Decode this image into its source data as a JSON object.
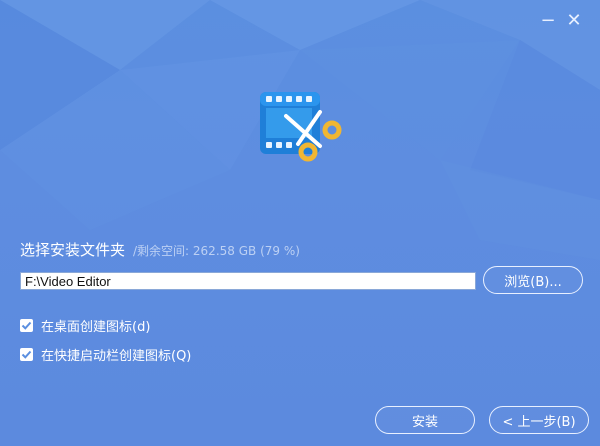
{
  "window": {
    "minimize_glyph": "−",
    "close_glyph": "✕"
  },
  "logo": {
    "icon": "video-editor-scissors-icon"
  },
  "folder": {
    "title": "选择安装文件夹",
    "space_info": "/剩余空间: 262.58 GB (79 %)",
    "path_value": "F:\\Video Editor",
    "browse_label": "浏览(B)..."
  },
  "options": [
    {
      "label": "在桌面创建图标(d)",
      "checked": true
    },
    {
      "label": "在快捷启动栏创建图标(Q)",
      "checked": true
    }
  ],
  "footer": {
    "install_label": "安装",
    "back_label": "< 上一步(B)"
  },
  "colors": {
    "background": "#5b8fe0",
    "checkmark": "#5b8fe0",
    "logo_blue": "#2f8fe0",
    "logo_gold": "#f0b632"
  }
}
